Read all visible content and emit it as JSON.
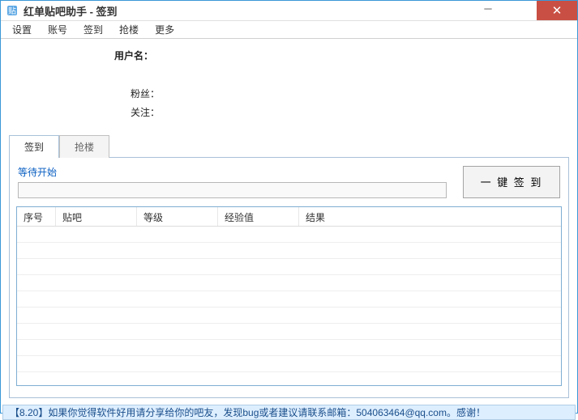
{
  "window": {
    "title": "红单贴吧助手 - 签到"
  },
  "menu": {
    "settings": "设置",
    "account": "账号",
    "signin": "签到",
    "qianglou": "抢楼",
    "more": "更多"
  },
  "user": {
    "username_label": "用户名：",
    "username_value": "",
    "fans_label": "粉丝：",
    "fans_value": "",
    "following_label": "关注：",
    "following_value": ""
  },
  "tabs": {
    "signin": "签到",
    "qianglou": "抢楼"
  },
  "action": {
    "status": "等待开始",
    "button": "一 键 签 到"
  },
  "table": {
    "cols": {
      "seq": "序号",
      "tieba": "贴吧",
      "level": "等级",
      "exp": "经验值",
      "result": "结果"
    }
  },
  "statusbar": {
    "text": "【8.20】如果你觉得软件好用请分享给你的吧友，发现bug或者建议请联系邮箱：504063464@qq.com。感谢！"
  }
}
